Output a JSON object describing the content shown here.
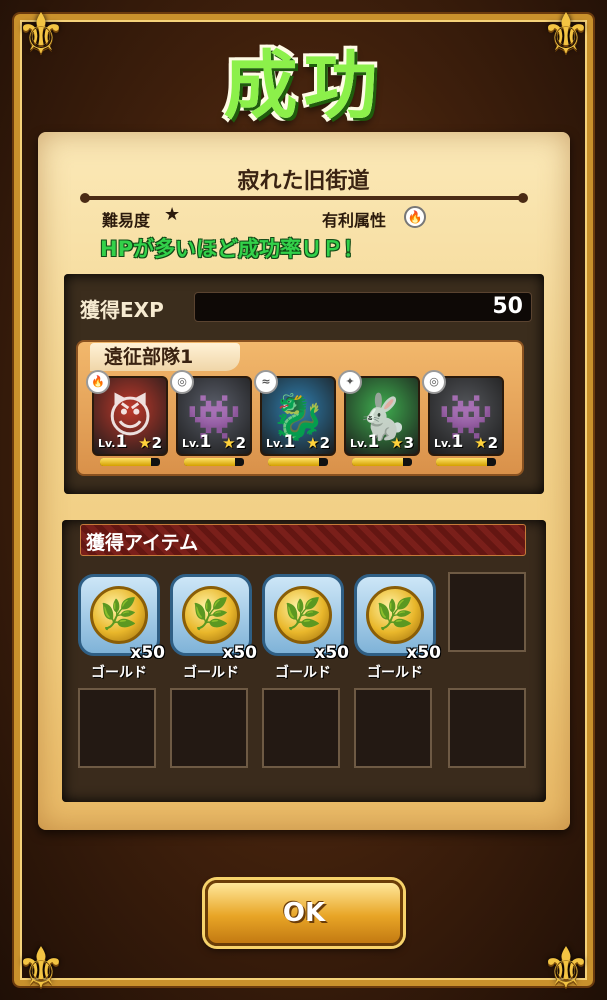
{
  "result": {
    "title": "成功"
  },
  "quest": {
    "name": "寂れた旧街道",
    "difficulty_label": "難易度",
    "difficulty_stars": "★",
    "attribute_label": "有利属性",
    "attribute_icon": "fire-element-icon",
    "hint": "HPが多いほど成功率ＵＰ！"
  },
  "exp": {
    "label": "獲得EXP",
    "value": "50"
  },
  "party": {
    "name": "遠征部隊1",
    "units": [
      {
        "element": "fire",
        "element_icon": "fire-element-icon",
        "lv_prefix": "Lv.",
        "level": "1",
        "rarity": "2",
        "color": "#c0392b",
        "hp_pct": 0.85
      },
      {
        "element": "neutral",
        "element_icon": "neutral-element-icon",
        "lv_prefix": "Lv.",
        "level": "1",
        "rarity": "2",
        "color": "#5b5f6b",
        "hp_pct": 0.85
      },
      {
        "element": "water",
        "element_icon": "water-element-icon",
        "lv_prefix": "Lv.",
        "level": "1",
        "rarity": "2",
        "color": "#2f7fb0",
        "hp_pct": 0.85
      },
      {
        "element": "wind",
        "element_icon": "wind-element-icon",
        "lv_prefix": "Lv.",
        "level": "1",
        "rarity": "3",
        "color": "#3fae4f",
        "hp_pct": 0.85
      },
      {
        "element": "neutral",
        "element_icon": "neutral-element-icon",
        "lv_prefix": "Lv.",
        "level": "1",
        "rarity": "2",
        "color": "#55575c",
        "hp_pct": 0.85
      }
    ]
  },
  "items": {
    "title": "獲得アイテム",
    "list": [
      {
        "name": "ゴールド",
        "qty": "x50",
        "icon": "gold-coin-icon"
      },
      {
        "name": "ゴールド",
        "qty": "x50",
        "icon": "gold-coin-icon"
      },
      {
        "name": "ゴールド",
        "qty": "x50",
        "icon": "gold-coin-icon"
      },
      {
        "name": "ゴールド",
        "qty": "x50",
        "icon": "gold-coin-icon"
      }
    ]
  },
  "ok_button": {
    "label": "OK"
  }
}
